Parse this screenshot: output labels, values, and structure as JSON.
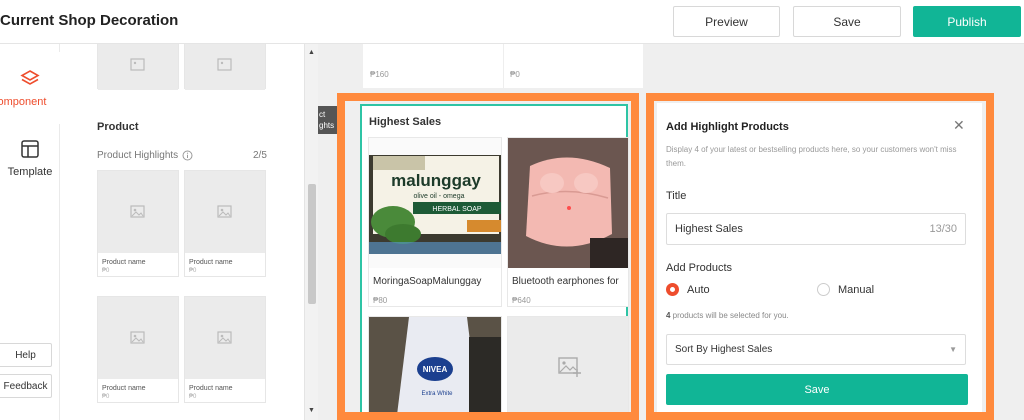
{
  "header": {
    "title": "Current Shop Decoration",
    "preview_label": "Preview",
    "save_label": "Save",
    "publish_label": "Publish"
  },
  "rail": {
    "component_label": "omponent",
    "template_label": "Template",
    "help_label": "Help",
    "feedback_label": "Feedback"
  },
  "panel": {
    "section_title": "Product",
    "subtitle": "Product Highlights",
    "count": "2/5",
    "cards": [
      {
        "name": "Product name",
        "price": "₱0"
      },
      {
        "name": "Product name",
        "price": "₱0"
      },
      {
        "name": "Product name",
        "price": "₱0"
      },
      {
        "name": "Product name",
        "price": "₱0"
      }
    ]
  },
  "canvas": {
    "prev_prices": [
      "₱160",
      "₱0"
    ],
    "tag_text": [
      "ct",
      "ghts"
    ],
    "highlight": {
      "title": "Highest Sales",
      "products": [
        {
          "name": "MoringaSoapMalunggay",
          "price": "₱80"
        },
        {
          "name": "Bluetooth earphones for",
          "price": "₱640"
        }
      ]
    },
    "soap_brand": "malunggay",
    "soap_sub": "olive oil - omega",
    "soap_banner": "HERBAL SOAP",
    "lotion_brand": "NIVEA",
    "lotion_sub": "Extra White"
  },
  "form": {
    "title": "Add Highlight Products",
    "description": "Display 4 of your latest or bestselling products here, so your customers won't miss them.",
    "title_label": "Title",
    "title_value": "Highest Sales",
    "title_counter": "13/30",
    "add_products_label": "Add Products",
    "radio_auto": "Auto",
    "radio_manual": "Manual",
    "hint_count": "4",
    "hint_text": " products will be selected for you.",
    "sort_value": "Sort By Highest Sales",
    "save_label": "Save"
  },
  "colors": {
    "accent": "#11b596",
    "brand": "#ee4d2d",
    "highlight_frame": "#ff8a3d"
  }
}
